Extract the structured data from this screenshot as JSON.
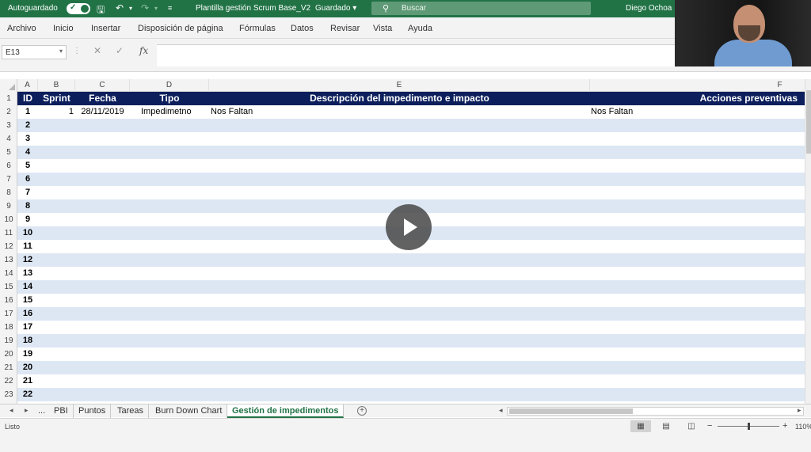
{
  "title_bar": {
    "autosave_label": "Autoguardado",
    "document_title": "Plantilla gestión Scrum Base_V2",
    "saved_status": "Guardado",
    "search_placeholder": "Buscar",
    "user_name": "Diego Ochoa"
  },
  "menu": [
    "Archivo",
    "Inicio",
    "Insertar",
    "Disposición de página",
    "Fórmulas",
    "Datos",
    "Revisar",
    "Vista",
    "Ayuda"
  ],
  "formula_bar": {
    "name_box": "E13",
    "fx": "fx",
    "value": ""
  },
  "columns": [
    "A",
    "B",
    "C",
    "D",
    "E",
    "F"
  ],
  "table_header": {
    "id": "ID",
    "sprint": "Sprint",
    "fecha": "Fecha",
    "tipo": "Tipo",
    "descripcion": "Descripción del impedimento e impacto",
    "acciones": "Acciones preventivas"
  },
  "rows": [
    {
      "row_num": "2",
      "id": "1",
      "sprint": "1",
      "fecha": "28/11/2019",
      "tipo": "Impedimetno",
      "descripcion": "Nos Faltan",
      "acciones": "Nos Faltan"
    },
    {
      "row_num": "3",
      "id": "2"
    },
    {
      "row_num": "4",
      "id": "3"
    },
    {
      "row_num": "5",
      "id": "4"
    },
    {
      "row_num": "6",
      "id": "5"
    },
    {
      "row_num": "7",
      "id": "6"
    },
    {
      "row_num": "8",
      "id": "7"
    },
    {
      "row_num": "9",
      "id": "8"
    },
    {
      "row_num": "10",
      "id": "9"
    },
    {
      "row_num": "11",
      "id": "10"
    },
    {
      "row_num": "12",
      "id": "11"
    },
    {
      "row_num": "13",
      "id": "12"
    },
    {
      "row_num": "14",
      "id": "13"
    },
    {
      "row_num": "15",
      "id": "14"
    },
    {
      "row_num": "16",
      "id": "15"
    },
    {
      "row_num": "17",
      "id": "16"
    },
    {
      "row_num": "18",
      "id": "17"
    },
    {
      "row_num": "19",
      "id": "18"
    },
    {
      "row_num": "20",
      "id": "19"
    },
    {
      "row_num": "21",
      "id": "20"
    },
    {
      "row_num": "22",
      "id": "21"
    },
    {
      "row_num": "23",
      "id": "22"
    }
  ],
  "header_row_num": "1",
  "sheet_tabs": {
    "ellipsis": "...",
    "tabs": [
      "PBI",
      "Puntos",
      "Tareas",
      "Burn Down Chart",
      "Gestión de impedimentos"
    ],
    "active": "Gestión de impedimentos"
  },
  "status_bar": {
    "ready": "Listo",
    "zoom": "110%"
  },
  "colors": {
    "excel_green": "#217346",
    "header_navy": "#0c1f5c",
    "stripe": "#dde7f4"
  },
  "icons": [
    "save-icon",
    "undo-icon",
    "redo-icon",
    "customize-icon",
    "search-icon",
    "play-icon"
  ]
}
